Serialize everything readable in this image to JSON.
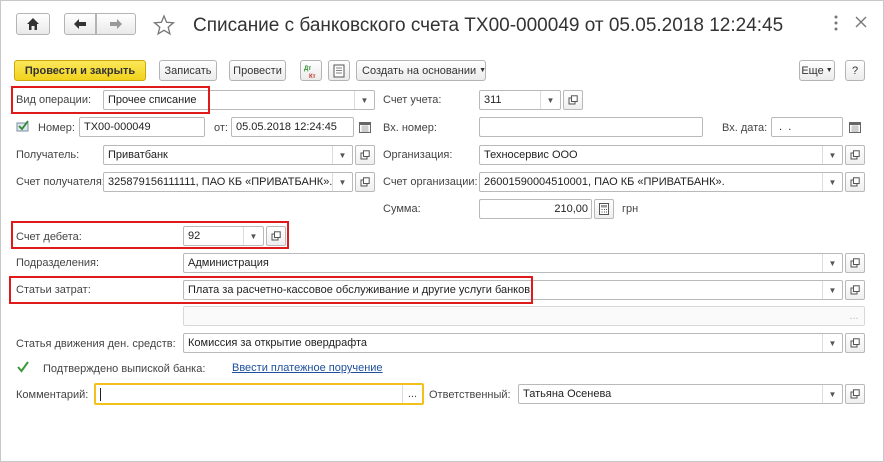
{
  "window": {
    "title": "Списание с банковского счета ТХ00-000049 от 05.05.2018 12:24:45"
  },
  "toolbar": {
    "post_and_close": "Провести и закрыть",
    "save": "Записать",
    "post": "Провести",
    "dt_kt": "ДтКт",
    "create_based_on": "Создать на основании",
    "more": "Еще",
    "help": "?"
  },
  "form": {
    "operation_type": {
      "label": "Вид операции:",
      "value": "Прочее списание"
    },
    "account": {
      "label": "Счет учета:",
      "value": "311"
    },
    "number": {
      "label": "Номер:",
      "value": "ТХ00-000049"
    },
    "date": {
      "label": "от:",
      "value": "05.05.2018 12:24:45"
    },
    "incoming_number": {
      "label": "Вх. номер:",
      "value": ""
    },
    "incoming_date": {
      "label": "Вх. дата:",
      "value": " .  .  "
    },
    "recipient": {
      "label": "Получатель:",
      "value": "Приватбанк"
    },
    "organization": {
      "label": "Организация:",
      "value": "Техносервис ООО"
    },
    "recipient_account": {
      "label": "Счет получателя:",
      "value": "325879156111111, ПАО КБ «ПРИВАТБАНК»."
    },
    "organization_account": {
      "label": "Счет организации:",
      "value": "26001590004510001, ПАО КБ «ПРИВАТБАНК»."
    },
    "amount": {
      "label": "Сумма:",
      "value": "210,00",
      "currency": "грн"
    },
    "debit_account": {
      "label": "Счет дебета:",
      "value": "92"
    },
    "department": {
      "label": "Подразделения:",
      "value": "Администрация"
    },
    "cost_item": {
      "label": "Статьи затрат:",
      "value": "Плата за расчетно-кассовое обслуживание и другие услуги банков"
    },
    "cash_flow_item": {
      "label": "Статья движения ден. средств:",
      "value": "Комиссия за открытие овердрафта"
    },
    "confirmed": {
      "label": "Подтверждено выпиской банка:",
      "checked": true
    },
    "payment_order_link": "Ввести платежное поручение",
    "comment": {
      "label": "Комментарий:",
      "value": ""
    },
    "responsible": {
      "label": "Ответственный:",
      "value": "Татьяна Осенева"
    }
  },
  "icons": {
    "home": "home-icon",
    "back": "arrow-left-icon",
    "forward": "arrow-right-icon",
    "favorite": "star-icon",
    "more_window": "vertical-dots-icon",
    "close": "close-icon"
  },
  "colors": {
    "primary_button": "#f5d91f",
    "highlight_red": "#e0191b",
    "highlight_yellow": "#f2c21b",
    "link": "#1d4f9c"
  }
}
